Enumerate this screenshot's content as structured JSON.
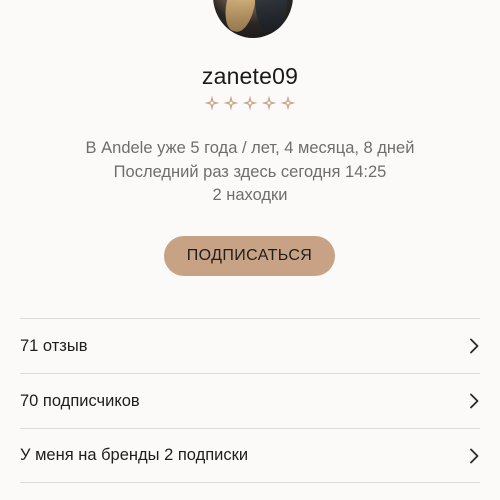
{
  "profile": {
    "username": "zanete09",
    "rating_stars": 5,
    "star_color": "#c9a98e",
    "info": [
      "В Andele уже 5 года / лет, 4 месяца, 8 дней",
      "Последний раз здесь сегодня 14:25",
      "2 находки"
    ]
  },
  "actions": {
    "subscribe_label": "ПОДПИСАТЬСЯ",
    "subscribe_color": "#c8a285"
  },
  "list": {
    "items": [
      {
        "label": "71 отзыв",
        "icon": "chevron-right-icon"
      },
      {
        "label": "70 подписчиков",
        "icon": "chevron-right-icon"
      },
      {
        "label": "У меня на бренды 2 подписки",
        "icon": "chevron-right-icon"
      }
    ]
  }
}
